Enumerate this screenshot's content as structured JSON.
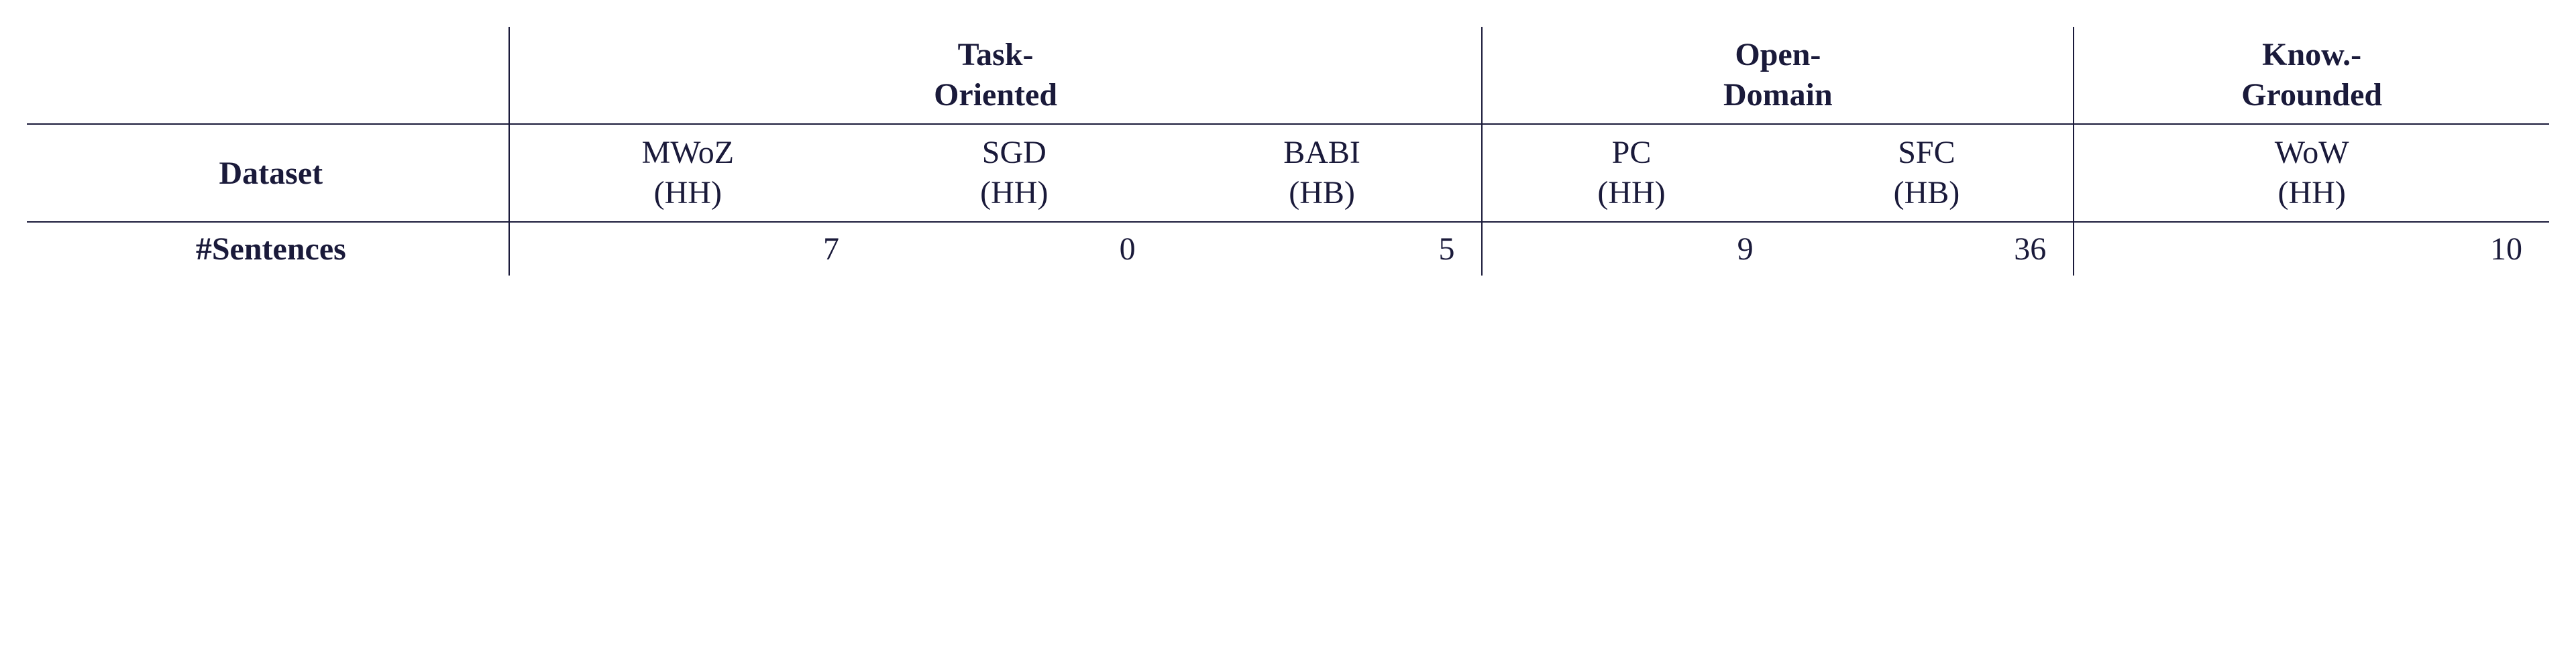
{
  "chart_data": {
    "type": "table",
    "title": "",
    "groups": [
      {
        "id": "task_oriented",
        "label_line1": "Task-",
        "label_line2": "Oriented",
        "columns": [
          "MWoZ",
          "SGD",
          "BABI"
        ]
      },
      {
        "id": "open_domain",
        "label_line1": "Open-",
        "label_line2": "Domain",
        "columns": [
          "PC",
          "SFC"
        ]
      },
      {
        "id": "know_grounded",
        "label_line1": "Know.-",
        "label_line2": "Grounded",
        "columns": [
          "WoW"
        ]
      }
    ],
    "rows": [
      {
        "label": "Dataset",
        "kind": "subheader"
      },
      {
        "label": "#Sentences",
        "kind": "data",
        "values": {
          "MWoZ": 7,
          "SGD": 0,
          "BABI": 5,
          "PC": 9,
          "SFC": 36,
          "WoW": 10
        }
      }
    ],
    "columns": [
      {
        "name": "MWoZ",
        "annot": "(HH)"
      },
      {
        "name": "SGD",
        "annot": "(HH)"
      },
      {
        "name": "BABI",
        "annot": "(HB)"
      },
      {
        "name": "PC",
        "annot": "(HH)"
      },
      {
        "name": "SFC",
        "annot": "(HB)"
      },
      {
        "name": "WoW",
        "annot": "(HH)"
      }
    ]
  },
  "labels": {
    "dataset_row": "Dataset",
    "sentences_row": "#Sentences"
  },
  "groups": {
    "task_oriented_line1": "Task-",
    "task_oriented_line2": "Oriented",
    "open_domain_line1": "Open-",
    "open_domain_line2": "Domain",
    "know_grounded_line1": "Know.-",
    "know_grounded_line2": "Grounded"
  },
  "cols": {
    "mwoz_name": "MWoZ",
    "mwoz_annot": "(HH)",
    "sgd_name": "SGD",
    "sgd_annot": "(HH)",
    "babi_name": "BABI",
    "babi_annot": "(HB)",
    "pc_name": "PC",
    "pc_annot": "(HH)",
    "sfc_name": "SFC",
    "sfc_annot": "(HB)",
    "wow_name": "WoW",
    "wow_annot": "(HH)"
  },
  "vals": {
    "mwoz": "7",
    "sgd": "0",
    "babi": "5",
    "pc": "9",
    "sfc": "36",
    "wow": "10"
  }
}
